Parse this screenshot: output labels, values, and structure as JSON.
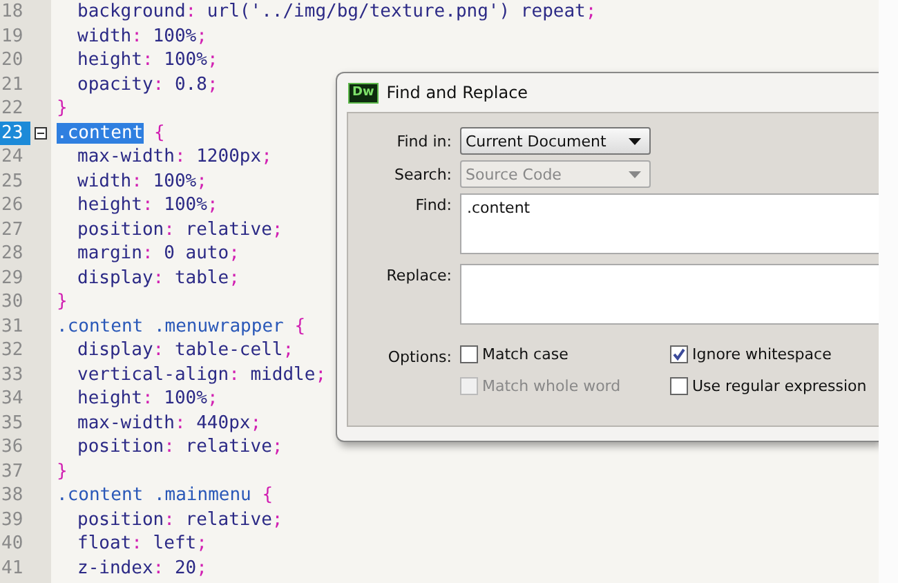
{
  "editor": {
    "lines": [
      {
        "number": "18",
        "kind": "decl",
        "selected": false,
        "text": "background: url('../img/bg/texture.png') repeat;"
      },
      {
        "number": "19",
        "kind": "decl",
        "selected": false,
        "text": "width: 100%;"
      },
      {
        "number": "20",
        "kind": "decl",
        "selected": false,
        "text": "height: 100%;"
      },
      {
        "number": "21",
        "kind": "decl",
        "selected": false,
        "text": "opacity: 0.8;"
      },
      {
        "number": "22",
        "kind": "rule",
        "selected": false,
        "text": "}"
      },
      {
        "number": "23",
        "kind": "rule",
        "selected": true,
        "text": ".content {"
      },
      {
        "number": "24",
        "kind": "decl",
        "selected": false,
        "text": "max-width: 1200px;"
      },
      {
        "number": "25",
        "kind": "decl",
        "selected": false,
        "text": "width: 100%;"
      },
      {
        "number": "26",
        "kind": "decl",
        "selected": false,
        "text": "height: 100%;"
      },
      {
        "number": "27",
        "kind": "decl",
        "selected": false,
        "text": "position: relative;"
      },
      {
        "number": "28",
        "kind": "decl",
        "selected": false,
        "text": "margin: 0 auto;"
      },
      {
        "number": "29",
        "kind": "decl",
        "selected": false,
        "text": "display: table;"
      },
      {
        "number": "30",
        "kind": "rule",
        "selected": false,
        "text": "}"
      },
      {
        "number": "31",
        "kind": "rule",
        "selected": false,
        "text": ".content .menuwrapper {"
      },
      {
        "number": "32",
        "kind": "decl",
        "selected": false,
        "text": "display: table-cell;"
      },
      {
        "number": "33",
        "kind": "decl",
        "selected": false,
        "text": "vertical-align: middle;"
      },
      {
        "number": "34",
        "kind": "decl",
        "selected": false,
        "text": "height: 100%;"
      },
      {
        "number": "35",
        "kind": "decl",
        "selected": false,
        "text": "max-width: 440px;"
      },
      {
        "number": "36",
        "kind": "decl",
        "selected": false,
        "text": "position: relative;"
      },
      {
        "number": "37",
        "kind": "rule",
        "selected": false,
        "text": "}"
      },
      {
        "number": "38",
        "kind": "rule",
        "selected": false,
        "text": ".content .mainmenu {"
      },
      {
        "number": "39",
        "kind": "decl",
        "selected": false,
        "text": "position: relative;"
      },
      {
        "number": "40",
        "kind": "decl",
        "selected": false,
        "text": "float: left;"
      },
      {
        "number": "41",
        "kind": "decl",
        "selected": false,
        "text": "z-index: 20;"
      }
    ]
  },
  "dialog": {
    "app_badge": "Dw",
    "title": "Find and Replace",
    "find_in": {
      "label": "Find in:",
      "value": "Current Document",
      "disabled": false
    },
    "search": {
      "label": "Search:",
      "value": "Source Code",
      "disabled": true
    },
    "find": {
      "label": "Find:",
      "value": ".content"
    },
    "replace": {
      "label": "Replace:"
    },
    "options_label": "Options:",
    "options": [
      {
        "label": "Match case",
        "checked": false,
        "disabled": false
      },
      {
        "label": "Ignore whitespace",
        "checked": true,
        "disabled": false
      },
      {
        "label": "Match whole word",
        "checked": false,
        "disabled": true
      },
      {
        "label": "Use regular expression",
        "checked": false,
        "disabled": false
      }
    ]
  }
}
